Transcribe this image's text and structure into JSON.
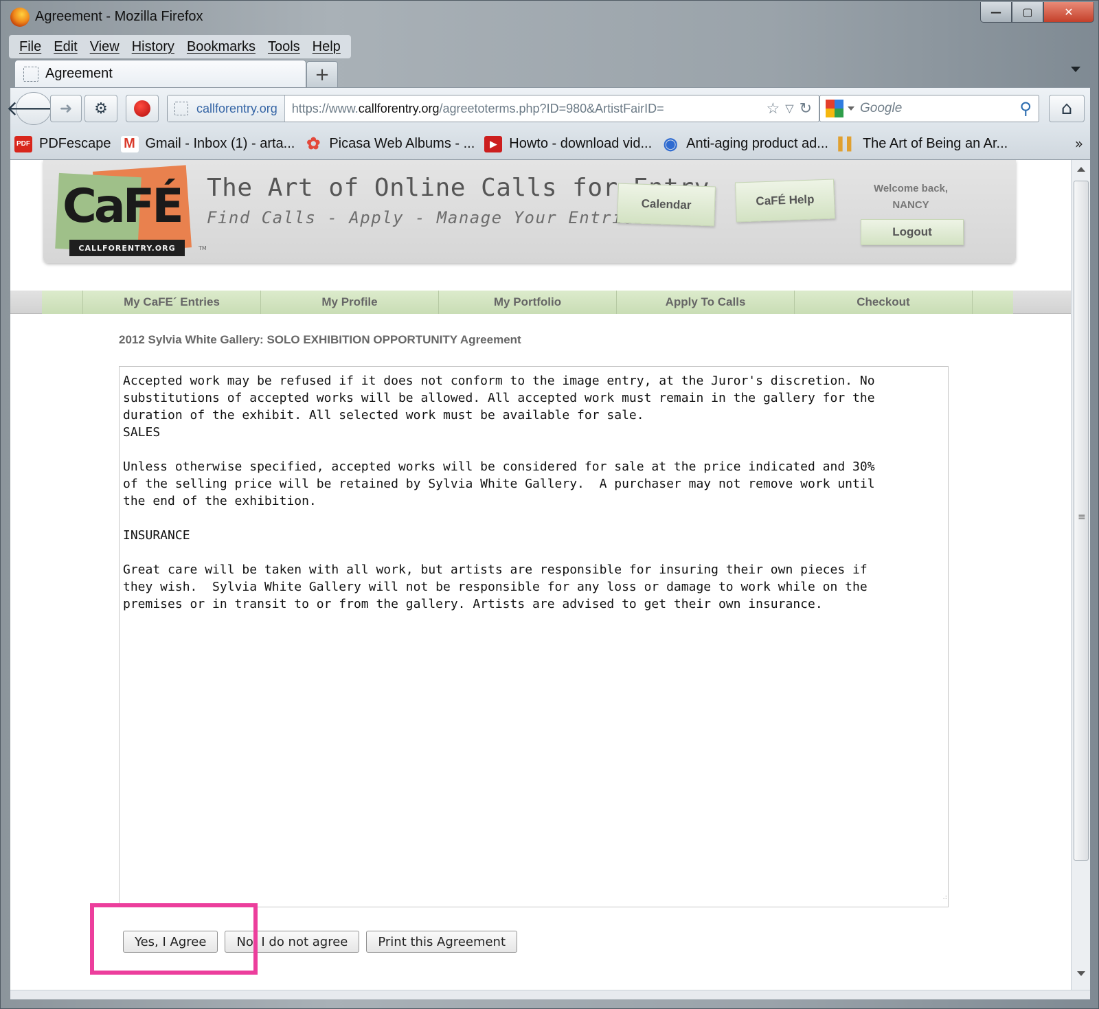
{
  "window": {
    "title": "Agreement - Mozilla Firefox",
    "controls": {
      "minimize": "—",
      "maximize": "▢",
      "close": "✕"
    }
  },
  "menubar": [
    "File",
    "Edit",
    "View",
    "History",
    "Bookmarks",
    "Tools",
    "Help"
  ],
  "tab": {
    "title": "Agreement",
    "new_tab": "+"
  },
  "urlbar": {
    "site_identity": "callforentry.org",
    "url_prefix": "https://www.",
    "url_domain": "callforentry.org",
    "url_rest": "/agreetoterms.php?ID=980&ArtistFairID="
  },
  "searchbar": {
    "placeholder": "Google"
  },
  "bookmarks": [
    {
      "label": "PDFescape",
      "icon": "pdf-icon",
      "color": "#d8261c",
      "glyph": "PDF"
    },
    {
      "label": "Gmail - Inbox (1) - arta...",
      "icon": "gmail-icon",
      "color": "#d93a2b",
      "glyph": "M"
    },
    {
      "label": "Picasa Web Albums - ...",
      "icon": "picasa-icon",
      "color": "#3a8fd6",
      "glyph": "✿"
    },
    {
      "label": "Howto - download vid...",
      "icon": "youtube-icon",
      "color": "#cc1e1e",
      "glyph": "▶"
    },
    {
      "label": "Anti-aging product ad...",
      "icon": "globe-icon",
      "color": "#2f6bd1",
      "glyph": "◉"
    },
    {
      "label": "The Art of Being an Ar...",
      "icon": "bookmark-stripes-icon",
      "color": "#e0a030",
      "glyph": "▌▌"
    }
  ],
  "header": {
    "logo_text": "CaFÉ",
    "logo_strip": "CALLFORENTRY.ORG",
    "logo_tm": "TM",
    "tagline": "The Art of Online Calls for Entry",
    "subtagline": "Find Calls - Apply - Manage Your Entries",
    "calendar": "Calendar",
    "help": "CaFÉ Help",
    "welcome": "Welcome back,",
    "user": "NANCY",
    "logout": "Logout"
  },
  "nav": [
    "My CaFE´ Entries",
    "My Profile",
    "My Portfolio",
    "Apply To Calls",
    "Checkout"
  ],
  "agreement": {
    "title": "2012 Sylvia White Gallery: SOLO EXHIBITION OPPORTUNITY Agreement",
    "text": "Accepted work may be refused if it does not conform to the image entry, at the Juror's discretion. No\nsubstitutions of accepted works will be allowed. All accepted work must remain in the gallery for the\nduration of the exhibit. All selected work must be available for sale.\nSALES\n\nUnless otherwise specified, accepted works will be considered for sale at the price indicated and 30%\nof the selling price will be retained by Sylvia White Gallery.  A purchaser may not remove work until\nthe end of the exhibition.\n\nINSURANCE\n\nGreat care will be taken with all work, but artists are responsible for insuring their own pieces if\nthey wish.  Sylvia White Gallery will not be responsible for any loss or damage to work while on the\npremises or in transit to or from the gallery. Artists are advised to get their own insurance."
  },
  "buttons": {
    "agree": "Yes, I Agree",
    "disagree": "No, I do not agree",
    "print": "Print this Agreement"
  },
  "colors": {
    "highlight": "#ec3e9c",
    "nav_green": "#c9ddb5",
    "logo_orange": "#e9814e",
    "logo_green": "#9fc089"
  }
}
